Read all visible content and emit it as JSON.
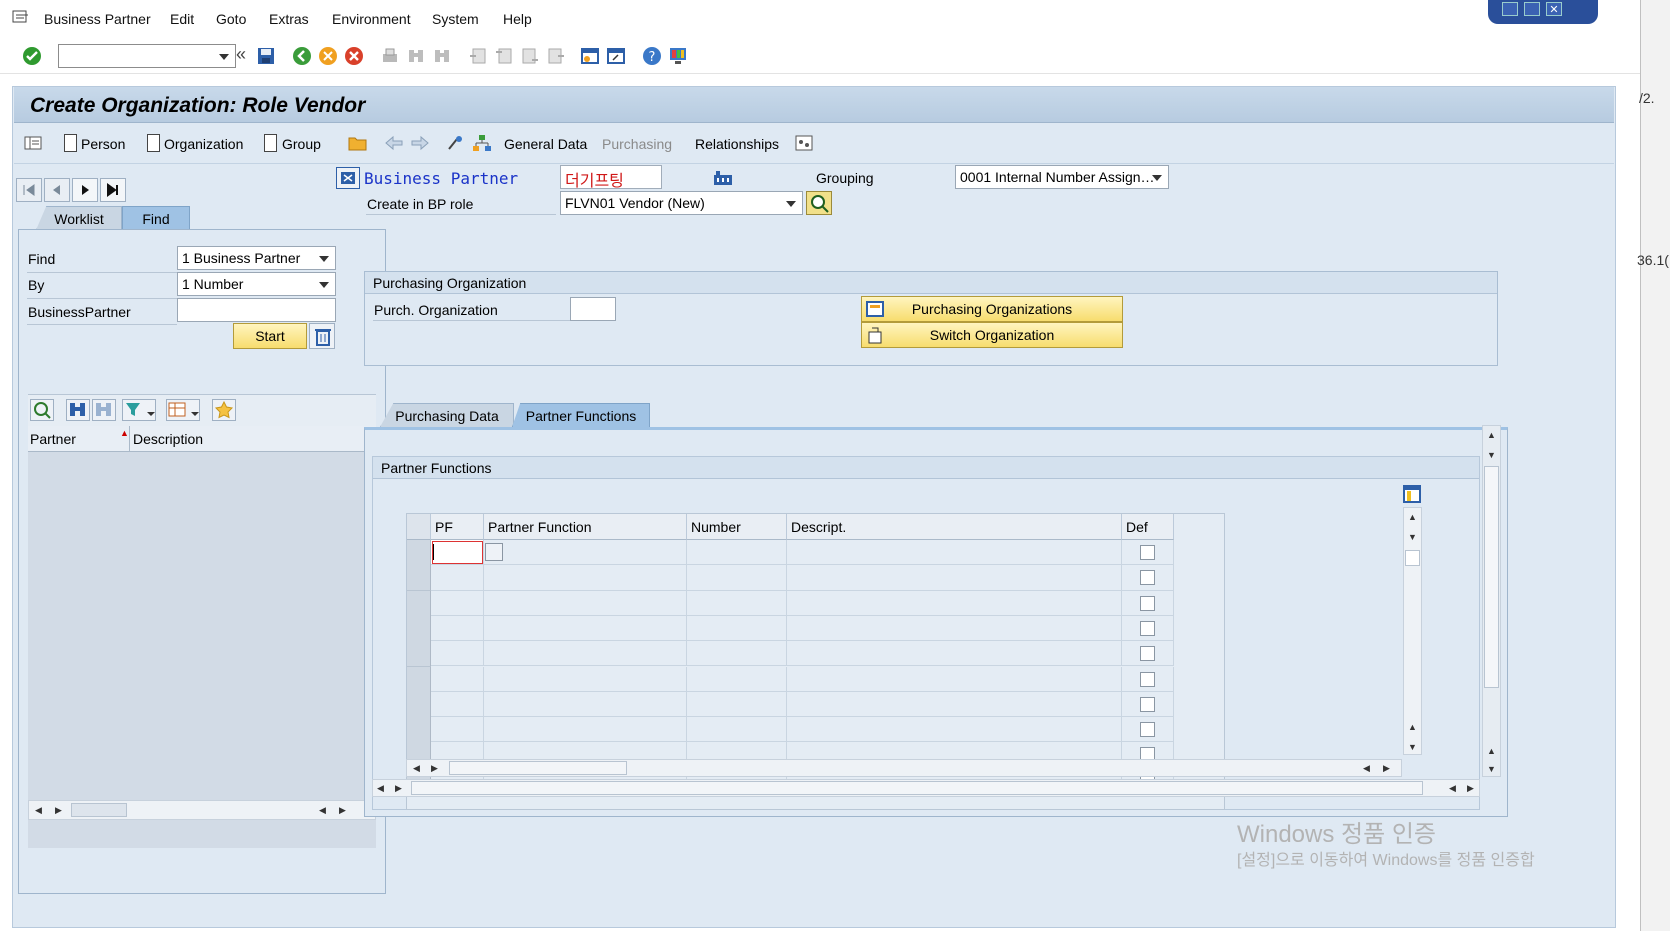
{
  "menu": {
    "items": [
      "Business Partner",
      "Edit",
      "Goto",
      "Extras",
      "Environment",
      "System",
      "Help"
    ]
  },
  "toolbar": {
    "command_value": "",
    "icons": [
      "enter-check-icon",
      "back-icon",
      "exit-icon",
      "cancel-icon",
      "print-icon",
      "find-icon",
      "find-next-icon",
      "first-page-icon",
      "previous-page-icon",
      "next-page-icon",
      "last-page-icon",
      "new-session-icon",
      "shortcut-icon",
      "help-icon",
      "customize-layout-icon"
    ],
    "save_symbol": "«"
  },
  "window": {
    "title": "Create Organization: Role Vendor"
  },
  "app_toolbar": {
    "person": "Person",
    "organization": "Organization",
    "group": "Group",
    "general_data": "General Data",
    "purchasing": "Purchasing",
    "relationships": "Relationships"
  },
  "left_panel": {
    "tabs": [
      "Worklist",
      "Find"
    ],
    "active_tab": "Find",
    "find_label": "Find",
    "find_value": "1 Business Partner",
    "by_label": "By",
    "by_value": "1 Number",
    "bp_label": "BusinessPartner",
    "bp_value": "",
    "start_label": "Start",
    "list_columns": [
      "Partner",
      "Description"
    ]
  },
  "header": {
    "bp_label": "Business Partner",
    "bp_value": "더기프팅",
    "grouping_label": "Grouping",
    "grouping_value": "0001 Internal Number Assign…",
    "role_label": "Create in BP role",
    "role_value": "FLVN01 Vendor (New)"
  },
  "purch_org": {
    "section_title": "Purchasing Organization",
    "field_label": "Purch. Organization",
    "field_value": "",
    "btn_orgs": "Purchasing Organizations",
    "btn_switch": "Switch Organization"
  },
  "tabs": {
    "items": [
      "Purchasing Data",
      "Partner Functions"
    ],
    "active": "Partner Functions"
  },
  "partner_functions": {
    "section_title": "Partner Functions",
    "columns": [
      "PF",
      "Partner Function",
      "Number",
      "Descript.",
      "Def"
    ],
    "row_count": 10
  },
  "watermark": {
    "line1": "Windows 정품 인증",
    "line2": "[설정]으로 이동하여 Windows를 정품 인증합"
  },
  "right_edge": {
    "text1": "/2.",
    "text2": "36.1("
  },
  "colors": {
    "frame_bg": "#dfe9f3",
    "title_bg": "#c8d9ea",
    "button_yellow": "#f7dd6e",
    "bp_text_blue": "#1a33c8",
    "bp_value_red": "#d01818"
  }
}
